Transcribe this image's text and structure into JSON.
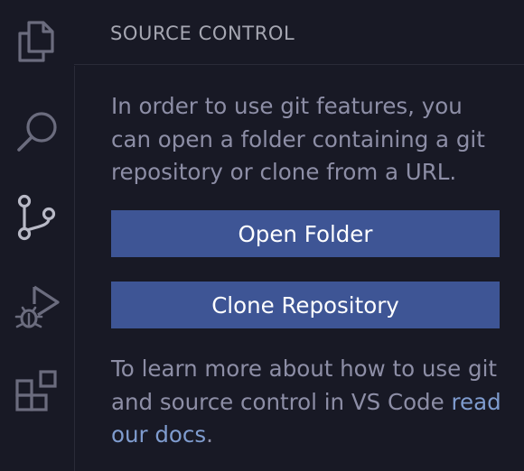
{
  "activity_bar": {
    "items": [
      {
        "name": "explorer",
        "icon": "files-icon"
      },
      {
        "name": "search",
        "icon": "search-icon"
      },
      {
        "name": "source-control",
        "icon": "source-control-icon"
      },
      {
        "name": "run-and-debug",
        "icon": "debug-icon"
      },
      {
        "name": "extensions",
        "icon": "extensions-icon"
      }
    ],
    "icon_color": "#6b6c7e",
    "active_icon_color": "#b8b9c6"
  },
  "sidebar": {
    "title": "SOURCE CONTROL",
    "message": "In order to use git features, you can open a folder containing a git repository or clone from a URL.",
    "open_folder_label": "Open Folder",
    "clone_repository_label": "Clone Repository",
    "learn_more_text": "To learn more about how to use git and source control in VS Code ",
    "docs_link_text": "read our docs",
    "learn_more_suffix": "."
  },
  "colors": {
    "background": "#181925",
    "button": "#3e5595",
    "text": "#8d8ea6",
    "link": "#7f9ccf"
  }
}
